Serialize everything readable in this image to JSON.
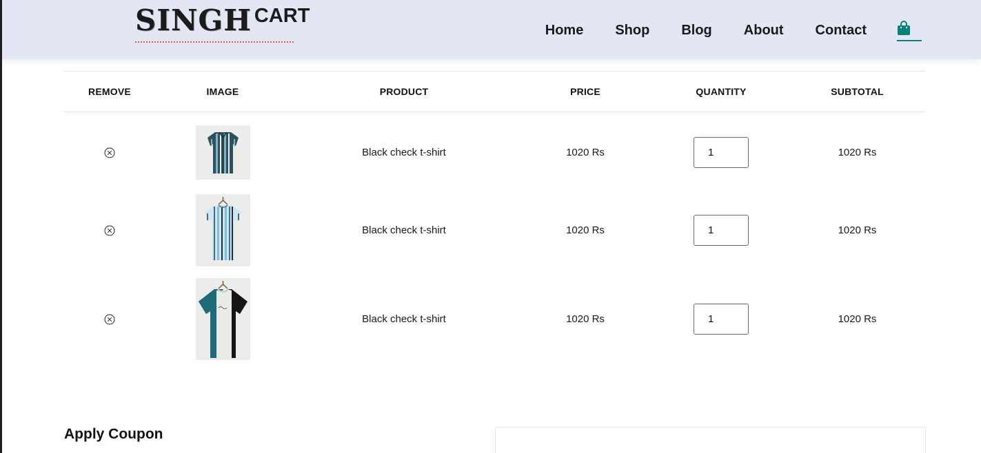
{
  "brand": {
    "main": "SINGH",
    "sup": "CART"
  },
  "nav": {
    "items": [
      {
        "label": "Home"
      },
      {
        "label": "Shop"
      },
      {
        "label": "Blog"
      },
      {
        "label": "About"
      },
      {
        "label": "Contact"
      }
    ],
    "cart_icon": "shopping-bag-icon"
  },
  "colors": {
    "navbar_bg": "#e3e6f3",
    "accent": "#088178",
    "logo_underline": "#e8574f"
  },
  "cart": {
    "headers": [
      "REMOVE",
      "IMAGE",
      "PRODUCT",
      "PRICE",
      "QUANTITY",
      "SUBTOTAL"
    ],
    "rows": [
      {
        "remove_icon": "circle-x-icon",
        "image": "striped-shirt-dark",
        "product": "Black check t-shirt",
        "price": "1020 Rs",
        "quantity": "1",
        "subtotal": "1020 Rs"
      },
      {
        "remove_icon": "circle-x-icon",
        "image": "striped-shirt-light-blue",
        "product": "Black check t-shirt",
        "price": "1020 Rs",
        "quantity": "1",
        "subtotal": "1020 Rs"
      },
      {
        "remove_icon": "circle-x-icon",
        "image": "colorblock-tee",
        "product": "Black check t-shirt",
        "price": "1020 Rs",
        "quantity": "1",
        "subtotal": "1020 Rs"
      }
    ]
  },
  "coupon": {
    "title": "Apply Coupon"
  }
}
